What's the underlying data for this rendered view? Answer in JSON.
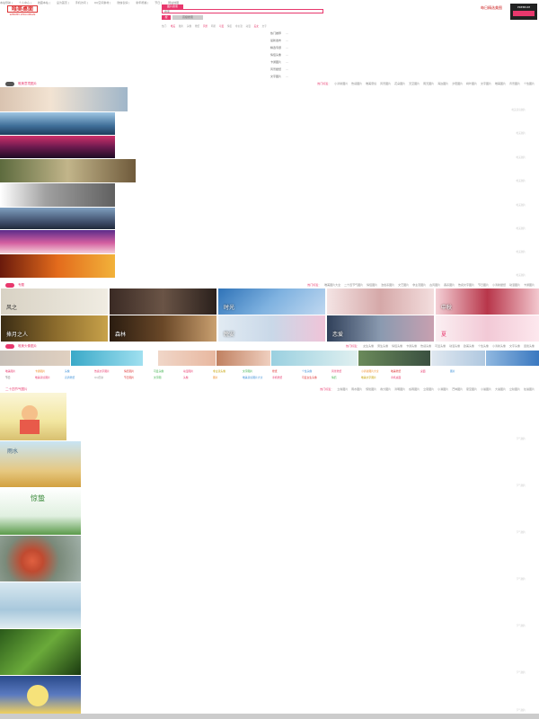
{
  "topbar": [
    "本站导航 |",
    "个人中心 |",
    "收藏本站 |",
    "设为首页 |",
    "手机访问 |",
    "QQ空间素材 |",
    "微信表情 |",
    "新年祝福 |",
    "节日 |",
    "网站地图"
  ],
  "logo": {
    "mark": "唯美桌面",
    "sub": "WEIMEI ZHUOMIAN"
  },
  "search": {
    "tabs": [
      "图片搜索"
    ],
    "placeholder": "搜索",
    "button": "搜",
    "extra": "高级搜索"
  },
  "hotwords": [
    "热门:",
    "唯美",
    "图片",
    "头像",
    "壁纸",
    "风景",
    "明星",
    "可爱",
    "情侣",
    "非主流",
    "动漫",
    "美女",
    "文字"
  ],
  "topright": {
    "text": "每日精选美图",
    "badge": "PREMIUM"
  },
  "dropdown": {
    "items": [
      "热门推荐",
      "最新发布",
      "精选专题",
      "情侣头像",
      "卡通图片",
      "风景壁纸",
      "文字图片"
    ],
    "arrows": [
      "—",
      "—",
      "—",
      "—",
      "—",
      "—",
      "—"
    ]
  },
  "section1": {
    "title": "唯美意境图片",
    "tags_lead": "热门标签：",
    "tags": [
      "小清新图片",
      "伤感图片",
      "唯美意境",
      "风景图片",
      "花朵图片",
      "天空图片",
      "雨天图片",
      "海边图片",
      "夕阳图片",
      "树叶图片",
      "文字图片",
      "唯美图片",
      "背景图片",
      "个性图片"
    ]
  },
  "section2": {
    "title": "专题",
    "tags_lead": "热门标签：",
    "tags": [
      "唯美图片大全",
      "二十四节气图片",
      "情侣图片",
      "治愈系图片",
      "文艺图片",
      "非主流图片",
      "古风图片",
      "森系图片",
      "伤感文字图片",
      "节日图片",
      "小清新壁纸",
      "动漫图片",
      "卡通图片"
    ]
  },
  "grid_captions": [
    "风之",
    "",
    "时光",
    "",
    "中秋",
    "捧月之人",
    "森林",
    "晚安",
    "恋爱",
    "夏"
  ],
  "section3": {
    "title": "唯美头像图片",
    "tags_lead": "热门标签：",
    "tags": [
      "女生头像",
      "男生头像",
      "情侣头像",
      "卡通头像",
      "伤感头像",
      "可爱头像",
      "动漫头像",
      "欧美头像",
      "个性头像",
      "小清新头像",
      "文字头像",
      "闺蜜头像"
    ]
  },
  "colored_links_row1": [
    "唯美图片",
    "卡通图片",
    "头像",
    "伤感文字图片",
    "情侣图片",
    "可爱头像",
    "动漫图片",
    "非主流头像",
    "文字图片",
    "壁纸",
    "个性头像",
    "风景壁纸",
    "小清新图片大全",
    "唯美壁纸",
    "桌面",
    "图片"
  ],
  "colored_links_row2": [
    "节日",
    "唯美意境图片",
    "高清壁纸",
    "QQ皮肤",
    "节日图片",
    "文字图",
    "头像",
    "图片",
    "唯美意境图片大全",
    "手机壁纸",
    "可爱女生头像",
    "情侣",
    "唯美文字图片",
    "手机桌面"
  ],
  "colors_row1": [
    "#e8386d",
    "#f08a24",
    "#3b8fd8",
    "#e8386d",
    "#d33",
    "#3bb04a",
    "#e8386d",
    "#c4a000",
    "#3bb04a",
    "#d33",
    "#3b8fd8",
    "#e8386d",
    "#f08a24",
    "#d33",
    "#e8386d",
    "#3b8fd8"
  ],
  "colors_row2": [
    "#666",
    "#e8386d",
    "#3b8fd8",
    "#999",
    "#d33",
    "#3bb04a",
    "#e8386d",
    "#f08a24",
    "#3b8fd8",
    "#e8386d",
    "#d33",
    "#3bb04a",
    "#c4a000",
    "#e8386d"
  ],
  "section4": {
    "title": "二十四节气图片",
    "tags_lead": "热门标签：",
    "tags": [
      "立春图片",
      "雨水图片",
      "惊蛰图片",
      "春分图片",
      "清明图片",
      "谷雨图片",
      "立夏图片",
      "小满图片",
      "芒种图片",
      "夏至图片",
      "小暑图片",
      "大暑图片",
      "立秋图片",
      "处暑图片"
    ]
  },
  "list_image_captions": [
    "",
    "雨水",
    "惊蛰",
    "",
    "",
    "",
    ""
  ],
  "right_labels": [
    "唯美意境图片",
    "唯美图片",
    "唯美图片",
    "唯美图片",
    "唯美图片",
    "唯美图片",
    "唯美图片",
    "唯美图片",
    "节气图片",
    "节气图片",
    "节气图片",
    "节气图片",
    "节气图片",
    "节气图片",
    "节气图片"
  ]
}
